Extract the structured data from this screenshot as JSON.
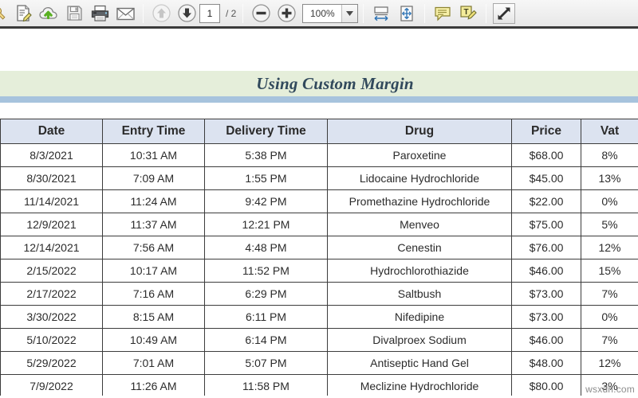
{
  "toolbar": {
    "buttons": [
      {
        "name": "security-lock-icon",
        "label": "Security"
      },
      {
        "name": "edit-document-icon",
        "label": "Edit Document"
      },
      {
        "name": "cloud-upload-icon",
        "label": "Upload to Cloud"
      },
      {
        "name": "save-icon",
        "label": "Save"
      },
      {
        "name": "print-icon",
        "label": "Print"
      },
      {
        "name": "email-icon",
        "label": "Email"
      }
    ],
    "nav": {
      "previous_page_label": "Previous Page",
      "next_page_label": "Next Page",
      "current_page": "1",
      "page_separator": "/ 2",
      "total_pages": "2"
    },
    "zoom": {
      "zoom_out_label": "Zoom Out",
      "zoom_in_label": "Zoom In",
      "value": "100%",
      "dropdown_label": "Zoom presets"
    },
    "view_buttons": [
      {
        "name": "fit-width-icon",
        "label": "Fit Width"
      },
      {
        "name": "fit-page-icon",
        "label": "Fit Page"
      }
    ],
    "annotate_buttons": [
      {
        "name": "sticky-note-icon",
        "label": "Add Note"
      },
      {
        "name": "text-highlight-icon",
        "label": "Highlight Text"
      }
    ],
    "expand": {
      "name": "fullscreen-icon",
      "label": "Full Screen"
    }
  },
  "document": {
    "title": "Using Custom Margin",
    "watermark": "wsxdn.com",
    "table": {
      "headers": [
        "Date",
        "Entry Time",
        "Delivery Time",
        "Drug",
        "Price",
        "Vat"
      ],
      "rows": [
        [
          "8/3/2021",
          "10:31 AM",
          "5:38 PM",
          "Paroxetine",
          "$68.00",
          "8%"
        ],
        [
          "8/30/2021",
          "7:09 AM",
          "1:55 PM",
          "Lidocaine Hydrochloride",
          "$45.00",
          "13%"
        ],
        [
          "11/14/2021",
          "11:24 AM",
          "9:42 PM",
          "Promethazine Hydrochloride",
          "$22.00",
          "0%"
        ],
        [
          "12/9/2021",
          "11:37 AM",
          "12:21 PM",
          "Menveo",
          "$75.00",
          "5%"
        ],
        [
          "12/14/2021",
          "7:56 AM",
          "4:48 PM",
          "Cenestin",
          "$76.00",
          "12%"
        ],
        [
          "2/15/2022",
          "10:17 AM",
          "11:52 PM",
          "Hydrochlorothiazide",
          "$46.00",
          "15%"
        ],
        [
          "2/17/2022",
          "7:16 AM",
          "6:29 PM",
          "Saltbush",
          "$73.00",
          "7%"
        ],
        [
          "3/30/2022",
          "8:15 AM",
          "6:11 PM",
          "Nifedipine",
          "$73.00",
          "0%"
        ],
        [
          "5/10/2022",
          "10:49 AM",
          "6:14 PM",
          "Divalproex Sodium",
          "$46.00",
          "7%"
        ],
        [
          "5/29/2022",
          "7:01 AM",
          "5:07 PM",
          "Antiseptic Hand Gel",
          "$48.00",
          "12%"
        ],
        [
          "7/9/2022",
          "11:26 AM",
          "11:58 PM",
          "Meclizine Hydrochloride",
          "$80.00",
          "3%"
        ]
      ]
    }
  },
  "colors": {
    "title_band": "#e5eeda",
    "title_underline": "#a7c3dd",
    "title_text": "#31495c",
    "header_fill": "#dce3f0",
    "grid_line": "#3c3c3c",
    "toolbar_bg": "#efefef"
  }
}
